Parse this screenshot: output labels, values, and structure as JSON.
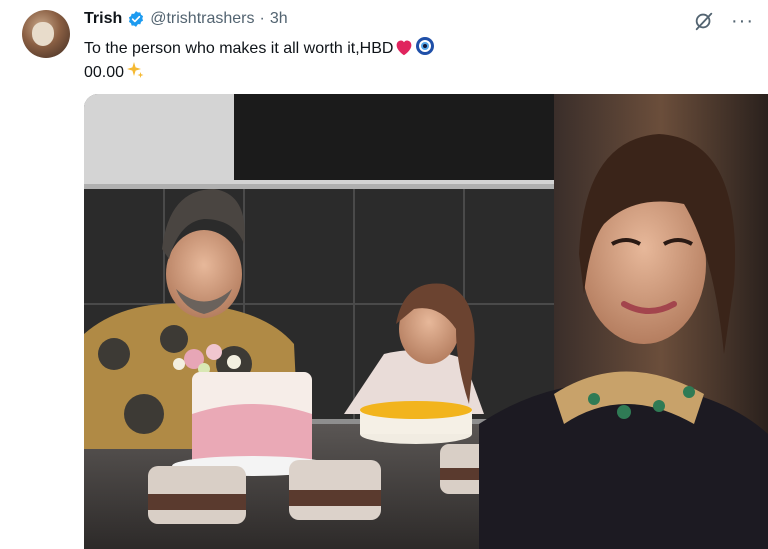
{
  "tweet": {
    "author_name": "Trish",
    "handle": "@trishtrashers",
    "separator": "·",
    "time": "3h",
    "text_line1": "To the person who makes it all worth it,HBD",
    "text_line2": "00.00",
    "verified_icon": "verified-badge-icon",
    "emojis": [
      "red-heart-icon",
      "nazar-amulet-icon",
      "sparkles-icon"
    ]
  },
  "actions": {
    "grok_icon": "grok-icon",
    "more_label": "···"
  },
  "media": {
    "description_icon": "photo-collage",
    "colors": {
      "accent": "#1d9bf0",
      "heart": "#e0245e"
    }
  }
}
